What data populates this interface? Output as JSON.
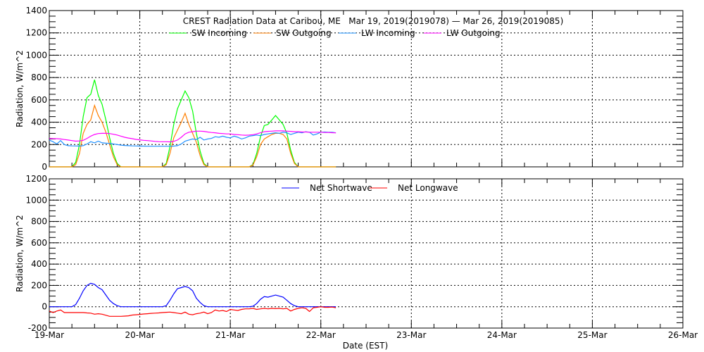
{
  "chart_data": [
    {
      "type": "line",
      "title": "CREST Radiation Data at Caribou, ME   Mar 19, 2019(2019078) — Mar 26, 2019(2019085)",
      "xlabel": "",
      "ylabel": "Radiation, W/m^2",
      "ylim": [
        0,
        1400
      ],
      "yticks": [
        0,
        200,
        400,
        600,
        800,
        1000,
        1200,
        1400
      ],
      "xlim_days": [
        0,
        7
      ],
      "x_step_hours": 1,
      "grid": true,
      "legend_position": "top",
      "series": [
        {
          "name": "SW Incoming",
          "color": "#00ff00",
          "values": [
            0,
            0,
            0,
            0,
            0,
            0,
            0,
            40,
            200,
            450,
            620,
            650,
            780,
            640,
            560,
            420,
            260,
            120,
            30,
            0,
            0,
            0,
            0,
            0,
            0,
            0,
            0,
            0,
            0,
            0,
            0,
            30,
            180,
            380,
            520,
            600,
            680,
            620,
            500,
            300,
            140,
            30,
            0,
            0,
            0,
            0,
            0,
            0,
            0,
            0,
            0,
            0,
            0,
            0,
            20,
            120,
            270,
            370,
            380,
            420,
            460,
            420,
            380,
            300,
            150,
            40,
            0,
            0,
            0,
            0,
            0,
            0,
            0,
            0,
            0,
            0,
            0
          ]
        },
        {
          "name": "SW Outgoing",
          "color": "#ff7f00",
          "values": [
            0,
            0,
            0,
            0,
            0,
            0,
            0,
            20,
            120,
            300,
            380,
            420,
            550,
            460,
            400,
            310,
            200,
            90,
            20,
            0,
            0,
            0,
            0,
            0,
            0,
            0,
            0,
            0,
            0,
            0,
            0,
            20,
            120,
            260,
            330,
            400,
            480,
            380,
            300,
            220,
            100,
            20,
            0,
            0,
            0,
            0,
            0,
            0,
            0,
            0,
            0,
            0,
            0,
            0,
            15,
            90,
            200,
            250,
            270,
            290,
            300,
            300,
            290,
            250,
            120,
            30,
            0,
            0,
            0,
            0,
            0,
            0,
            0,
            0,
            0,
            0,
            0
          ]
        },
        {
          "name": "LW Incoming",
          "color": "#1e90ff",
          "values": [
            240,
            225,
            205,
            235,
            200,
            190,
            188,
            187,
            186,
            190,
            205,
            225,
            215,
            230,
            215,
            212,
            210,
            205,
            200,
            195,
            192,
            190,
            188,
            187,
            186,
            186,
            185,
            185,
            185,
            185,
            185,
            185,
            185,
            186,
            190,
            205,
            230,
            240,
            250,
            245,
            265,
            240,
            250,
            255,
            270,
            265,
            275,
            265,
            260,
            275,
            265,
            250,
            260,
            275,
            280,
            285,
            280,
            290,
            295,
            300,
            305,
            300,
            310,
            305,
            290,
            300,
            310,
            305,
            315,
            310,
            285,
            295,
            310,
            312,
            310,
            310,
            305
          ]
        },
        {
          "name": "LW Outgoing",
          "color": "#ff00ff",
          "values": [
            255,
            253,
            252,
            250,
            245,
            240,
            235,
            230,
            232,
            238,
            255,
            275,
            290,
            298,
            300,
            300,
            298,
            292,
            285,
            275,
            265,
            258,
            252,
            246,
            242,
            238,
            235,
            232,
            228,
            226,
            225,
            225,
            224,
            228,
            240,
            265,
            295,
            310,
            315,
            320,
            320,
            318,
            312,
            308,
            305,
            300,
            298,
            295,
            295,
            290,
            288,
            285,
            283,
            285,
            288,
            295,
            305,
            315,
            318,
            320,
            322,
            322,
            322,
            320,
            318,
            315,
            315,
            312,
            312,
            310,
            310,
            310,
            310,
            308,
            308,
            306,
            305
          ]
        }
      ]
    },
    {
      "type": "line",
      "xlabel": "Date (EST)",
      "ylabel": "Radiation, W/m^2",
      "ylim": [
        -200,
        1200
      ],
      "yticks": [
        -200,
        0,
        200,
        400,
        600,
        800,
        1000,
        1200
      ],
      "xlim_days": [
        0,
        7
      ],
      "x_step_hours": 1,
      "xticks": [
        "19-Mar",
        "20-Mar",
        "21-Mar",
        "22-Mar",
        "23-Mar",
        "24-Mar",
        "25-Mar",
        "26-Mar"
      ],
      "grid": true,
      "legend_position": "top",
      "series": [
        {
          "name": "Net Shortwave",
          "color": "#0000ff",
          "values": [
            0,
            0,
            0,
            0,
            0,
            0,
            0,
            20,
            80,
            150,
            200,
            220,
            210,
            180,
            160,
            110,
            60,
            30,
            10,
            0,
            0,
            0,
            0,
            0,
            0,
            0,
            0,
            0,
            0,
            0,
            0,
            10,
            60,
            120,
            170,
            180,
            190,
            180,
            150,
            80,
            40,
            10,
            0,
            0,
            0,
            0,
            0,
            0,
            0,
            0,
            0,
            0,
            0,
            0,
            5,
            30,
            70,
            95,
            90,
            100,
            110,
            100,
            90,
            60,
            30,
            10,
            0,
            0,
            0,
            0,
            0,
            0,
            0,
            0,
            0,
            0,
            0
          ]
        },
        {
          "name": "Net Longwave",
          "color": "#ff0000",
          "values": [
            -40,
            -55,
            -40,
            -30,
            -55,
            -55,
            -55,
            -55,
            -55,
            -55,
            -58,
            -60,
            -70,
            -65,
            -70,
            -80,
            -90,
            -90,
            -90,
            -90,
            -88,
            -85,
            -78,
            -75,
            -72,
            -68,
            -65,
            -62,
            -60,
            -58,
            -55,
            -52,
            -50,
            -55,
            -60,
            -65,
            -50,
            -70,
            -75,
            -65,
            -60,
            -50,
            -65,
            -55,
            -30,
            -40,
            -35,
            -45,
            -25,
            -30,
            -35,
            -25,
            -20,
            -20,
            -15,
            -25,
            -20,
            -15,
            -20,
            -15,
            -18,
            -15,
            -20,
            -15,
            -40,
            -25,
            -15,
            -10,
            -15,
            -45,
            -10,
            -5,
            0,
            -5,
            -5,
            -3,
            -10
          ]
        }
      ]
    }
  ]
}
